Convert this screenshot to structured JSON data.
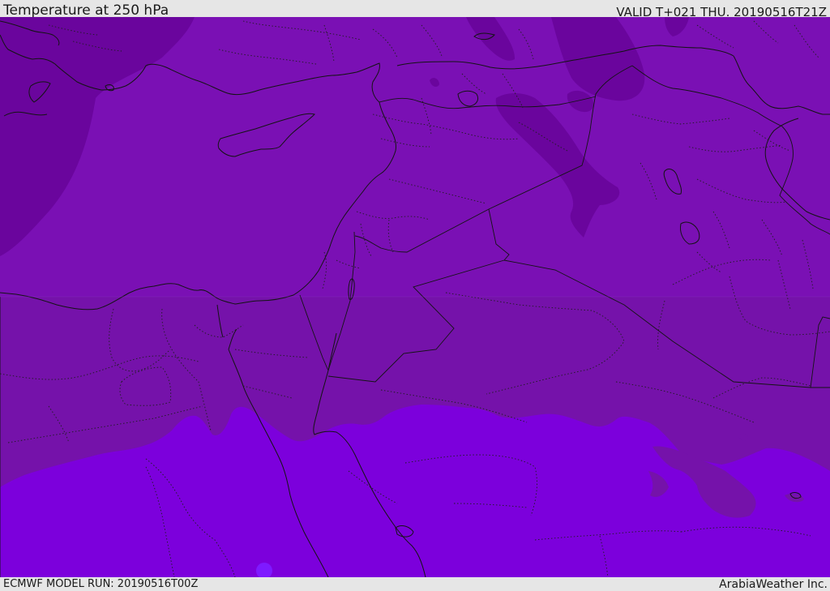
{
  "header": {
    "title": "Temperature at 250 hPa",
    "valid": "VALID T+021 THU. 20190516T21Z"
  },
  "footer": {
    "model_run": "ECMWF MODEL RUN: 20190516T00Z",
    "credit": "ArabiaWeather Inc."
  },
  "colors": {
    "band_cold": "#6a059d",
    "band_cool": "#7a10b4",
    "band_mid": "#7512aa",
    "band_warm": "#7c00dc",
    "warm_spot": "#7e1aff"
  }
}
